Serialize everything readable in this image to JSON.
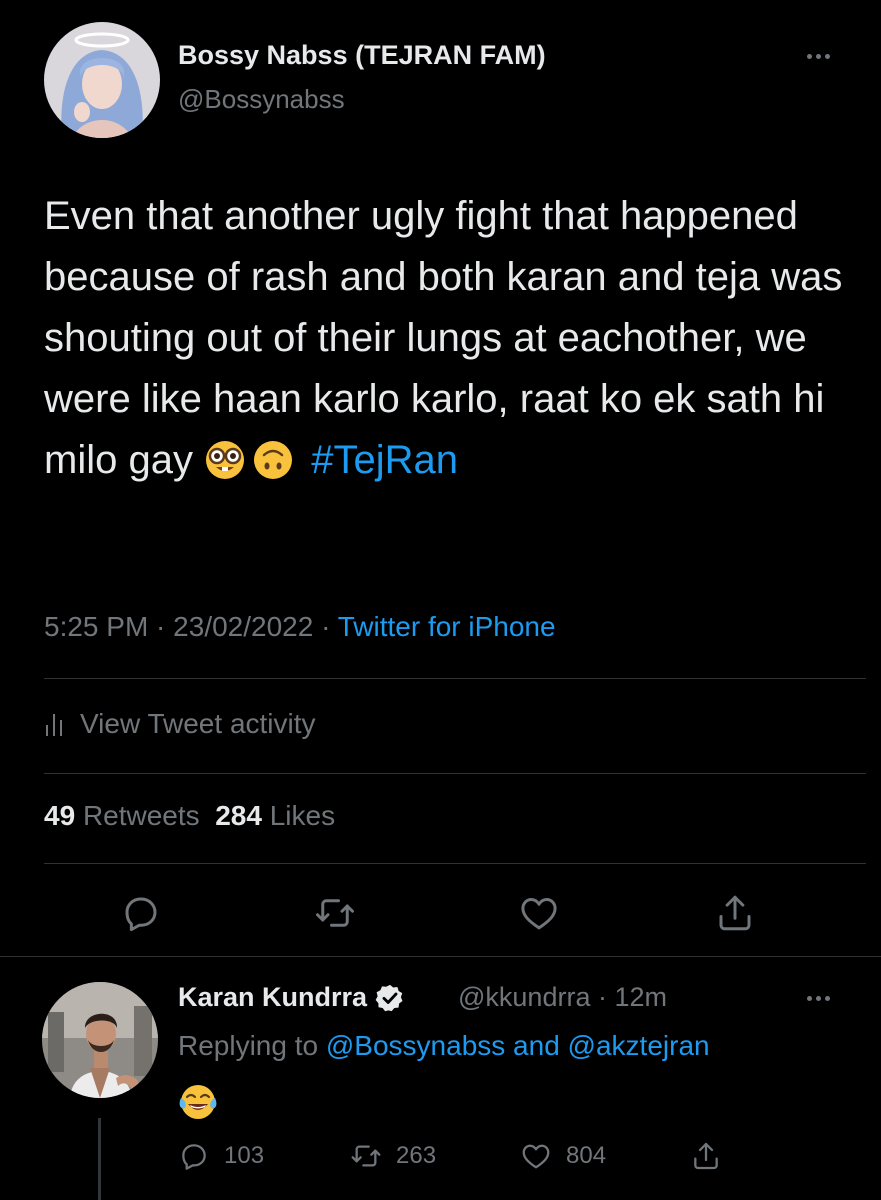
{
  "tweet": {
    "author_name": "Bossy Nabss (TEJRAN FAM)",
    "author_handle": "@Bossynabss",
    "text": "Even that another ugly fight that happened because of rash and both karan and teja was shouting out of their lungs at eachother, we were like haan karlo karlo, raat ko ek sath hi milo gay",
    "emojis": [
      "nerd-face-emoji",
      "upside-down-face-emoji"
    ],
    "hashtag": "#TejRan",
    "time": "5:25 PM",
    "date": "23/02/2022",
    "source": "Twitter for iPhone",
    "activity_label": "View Tweet activity",
    "retweets_count": "49",
    "retweets_label": "Retweets",
    "likes_count": "284",
    "likes_label": "Likes",
    "icons": [
      "reply-icon",
      "retweet-icon",
      "like-icon",
      "share-icon",
      "more-icon",
      "activity-bars-icon"
    ]
  },
  "reply": {
    "author_name": "Karan Kundrra",
    "verified": true,
    "author_handle": "@kkundrra",
    "age": "12m",
    "replying_prefix": "Replying to",
    "mention_1": "@Bossynabss",
    "conjunction": "and",
    "mention_2": "@akztejran",
    "emoji": "face-with-tears-of-joy-emoji",
    "reply_count": "103",
    "retweet_count": "263",
    "like_count": "804"
  },
  "colors": {
    "background": "#000000",
    "text": "#e7e9ea",
    "muted": "#71767b",
    "accent": "#1d9bf0",
    "divider": "#2f3336"
  }
}
